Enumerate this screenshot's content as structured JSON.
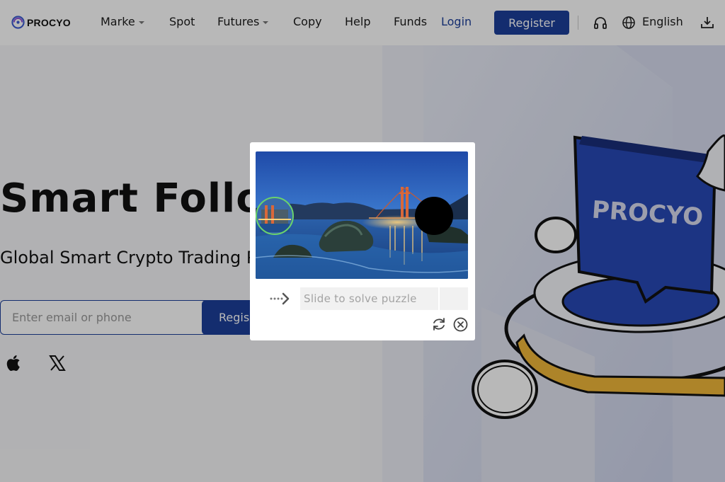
{
  "nav": {
    "logo_text": "PROCYO",
    "items": [
      {
        "label": "Marke",
        "has_caret": true
      },
      {
        "label": "Spot",
        "has_caret": false
      },
      {
        "label": "Futures",
        "has_caret": true
      },
      {
        "label": "Copy",
        "has_caret": false
      },
      {
        "label": "Help",
        "has_caret": false
      },
      {
        "label": "Funds",
        "has_caret": false
      }
    ],
    "login": "Login",
    "register": "Register",
    "language": "English",
    "icons": [
      "headset-icon",
      "globe-icon",
      "download-icon"
    ]
  },
  "hero": {
    "title": "Smart Follo",
    "subtitle": "Global Smart Crypto Trading P",
    "input_placeholder": "Enter email or phone",
    "button": "Regis",
    "social_icons": [
      "apple-icon",
      "x-icon"
    ],
    "illustration_text": "PROCYO"
  },
  "captcha": {
    "slider_text": "Slide to solve puzzle",
    "icons": [
      "slide-arrow-icon",
      "refresh-icon",
      "close-icon"
    ]
  },
  "colors": {
    "brand": "#1c3f9a",
    "overlay": "rgba(0,0,0,0.28)",
    "accent_yellow": "#f0b73a"
  }
}
